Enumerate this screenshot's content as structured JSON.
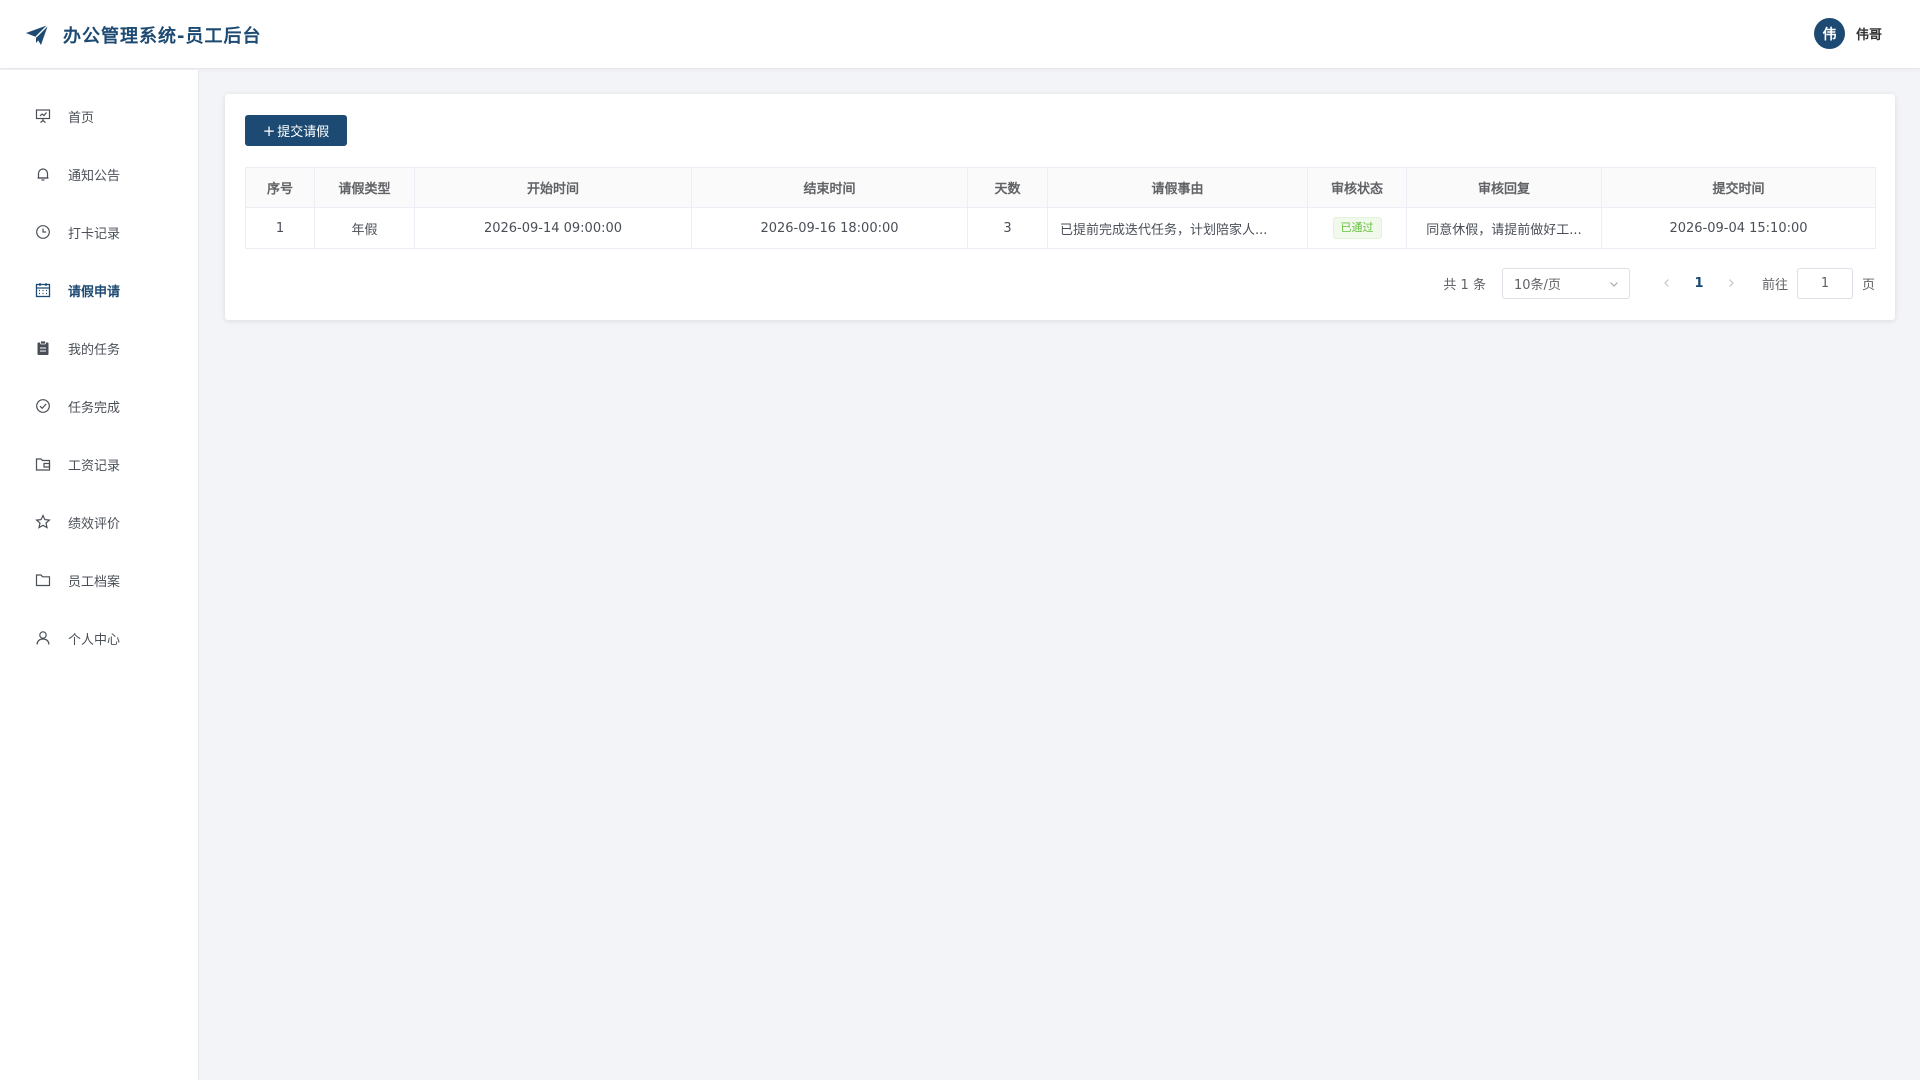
{
  "app": {
    "title": "办公管理系统-员工后台"
  },
  "user": {
    "avatar_text": "伟",
    "name": "伟哥"
  },
  "sidebar": {
    "items": [
      {
        "label": "首页",
        "icon": "presentation-icon"
      },
      {
        "label": "通知公告",
        "icon": "bell-icon"
      },
      {
        "label": "打卡记录",
        "icon": "clock-icon"
      },
      {
        "label": "请假申请",
        "icon": "calendar-icon",
        "active": true
      },
      {
        "label": "我的任务",
        "icon": "clipboard-icon"
      },
      {
        "label": "任务完成",
        "icon": "circle-check-icon"
      },
      {
        "label": "工资记录",
        "icon": "wallet-folder-icon"
      },
      {
        "label": "绩效评价",
        "icon": "star-icon"
      },
      {
        "label": "员工档案",
        "icon": "folder-icon"
      },
      {
        "label": "个人中心",
        "icon": "user-icon"
      }
    ]
  },
  "toolbar": {
    "add_label": "提交请假"
  },
  "table": {
    "columns": [
      "序号",
      "请假类型",
      "开始时间",
      "结束时间",
      "天数",
      "请假事由",
      "审核状态",
      "审核回复",
      "提交时间"
    ],
    "rows": [
      {
        "index": "1",
        "type": "年假",
        "start": "2026-09-14 09:00:00",
        "end": "2026-09-16 18:00:00",
        "days": "3",
        "reason": "已提前完成迭代任务，计划陪家人...",
        "status": "已通过",
        "reply": "同意休假，请提前做好工...",
        "submitted": "2026-09-04 15:10:00"
      }
    ]
  },
  "pagination": {
    "total_text": "共 1 条",
    "page_size": "10条/页",
    "current_page": "1",
    "goto_label": "前往",
    "goto_value": "1",
    "page_suffix": "页"
  },
  "colors": {
    "brand": "#1c4a72",
    "success": "#67c23a",
    "background": "#f3f4f7"
  }
}
